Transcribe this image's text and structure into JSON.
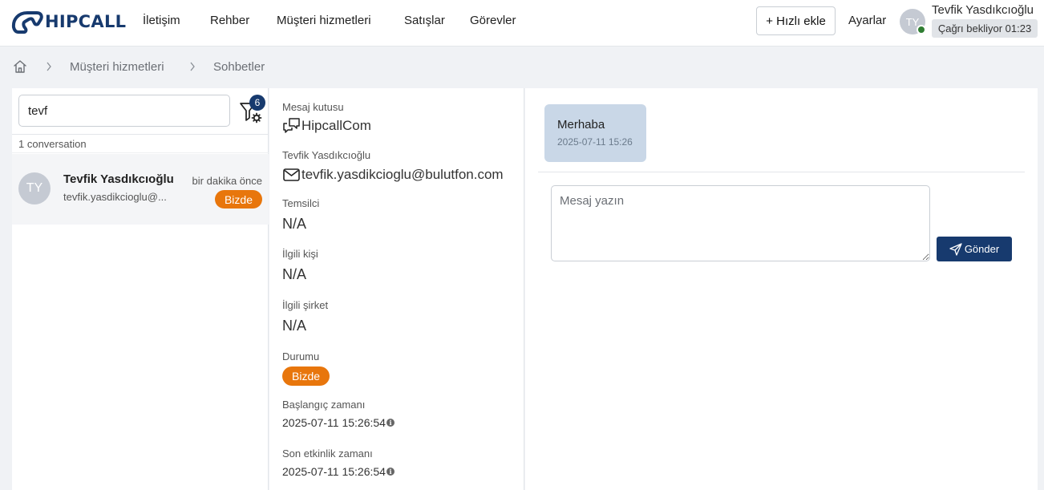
{
  "header": {
    "logo_text": "HIPCALL",
    "nav": [
      "İletişim",
      "Rehber",
      "Müşteri hizmetleri",
      "Satışlar",
      "Görevler"
    ],
    "quick_add_label": "+ Hızlı ekle",
    "settings_label": "Ayarlar",
    "user_initials": "TY",
    "user_name": "Tevfik Yasdıkcıoğlu",
    "call_status": "Çağrı bekliyor 01:23"
  },
  "breadcrumb": {
    "items": [
      "Müşteri hizmetleri",
      "Sohbetler"
    ]
  },
  "sidebar": {
    "search": {
      "value": "tevf",
      "placeholder": ""
    },
    "filter_count": "6",
    "conversation_count": "1 conversation",
    "conversations": [
      {
        "initials": "TY",
        "name": "Tevfik Yasdıkcıoğlu",
        "email": "tevfik.yasdikcioglu@...",
        "time": "bir dakika önce",
        "badge": "Bizde"
      }
    ]
  },
  "details": {
    "inbox_label": "Mesaj kutusu",
    "inbox_value": "HipcallCom",
    "contact_label": "Tevfik Yasdıkcıoğlu",
    "contact_email": "tevfik.yasdikcioglu@bulutfon.com",
    "agent_label": "Temsilci",
    "agent_value": "N/A",
    "person_label": "İlgili kişi",
    "person_value": "N/A",
    "company_label": "İlgili şirket",
    "company_value": "N/A",
    "state_label": "Durumu",
    "state_value": "Bizde",
    "start_label": "Başlangıç zamanı",
    "start_value": "2025-07-11 15:26:54",
    "last_label": "Son etkinlik zamanı",
    "last_value": "2025-07-11 15:26:54"
  },
  "chat": {
    "messages": [
      {
        "text": "Merhaba",
        "time": "2025-07-11 15:26"
      }
    ],
    "input_placeholder": "Mesaj yazın",
    "send_label": "Gönder"
  },
  "colors": {
    "brand": "#173a6e",
    "status_badge": "#e8760c",
    "online": "#2f7d32",
    "bubble": "#c9d7e7"
  }
}
